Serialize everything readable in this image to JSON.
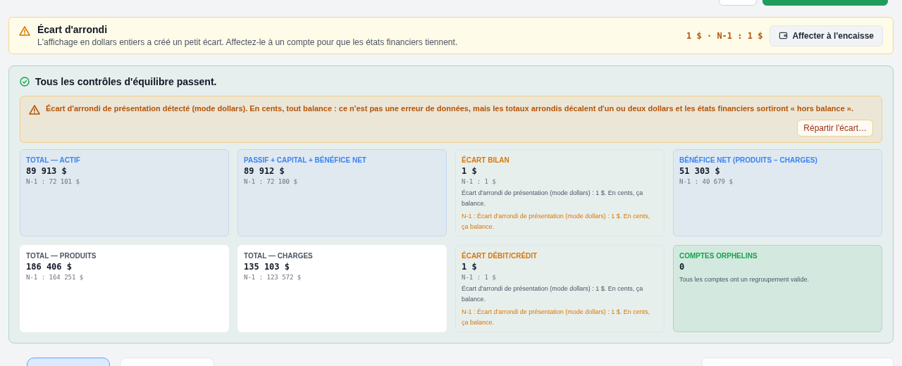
{
  "banner": {
    "title": "Écart d'arrondi",
    "message": "L'affichage en dollars entiers a créé un petit écart. Affectez-le à un compte pour que les états financiers tiennent.",
    "amounts": "1 $ · N-1 : 1 $",
    "button": "Affecter à l'encaisse"
  },
  "checks": {
    "status": "Tous les contrôles d'équilibre passent.",
    "passed": true,
    "alert": {
      "message": "Écart d'arrondi de présentation détecté (mode dollars). En cents, tout balance : ce n'est pas une erreur de données, mais les totaux arrondis décalent d'un ou deux dollars et les états financiers sortiront « hors balance ».",
      "button": "Répartir l'écart…"
    },
    "cards": [
      {
        "kind": "info",
        "label": "TOTAL — ACTIF",
        "value": "89 913 $",
        "previous": "N-1 : 72 101 $"
      },
      {
        "kind": "info",
        "label": "PASSIF + CAPITAL + BÉNÉFICE NET",
        "value": "89 912 $",
        "previous": "N-1 : 72 100 $"
      },
      {
        "kind": "warning",
        "label": "ÉCART BILAN",
        "value": "1 $",
        "previous": "N-1 : 1 $",
        "note": "Écart d'arrondi de présentation (mode dollars) : 1 $. En cents, ça balance.",
        "note_previous": "N-1 : Écart d'arrondi de présentation (mode dollars) : 1 $. En cents, ça balance."
      },
      {
        "kind": "info",
        "label": "BÉNÉFICE NET (PRODUITS − CHARGES)",
        "value": "51 303 $",
        "previous": "N-1 : 40 679 $"
      },
      {
        "kind": "neutral",
        "label": "TOTAL — PRODUITS",
        "value": "186 406 $",
        "previous": "N-1 : 164 251 $"
      },
      {
        "kind": "neutral",
        "label": "TOTAL — CHARGES",
        "value": "135 103 $",
        "previous": "N-1 : 123 572 $"
      },
      {
        "kind": "warning",
        "label": "ÉCART DÉBIT/CRÉDIT",
        "value": "1 $",
        "previous": "N-1 : 1 $",
        "note": "Écart d'arrondi de présentation (mode dollars) : 1 $. En cents, ça balance.",
        "note_previous": "N-1 : Écart d'arrondi de présentation (mode dollars) : 1 $. En cents, ça balance."
      },
      {
        "kind": "success",
        "label": "COMPTES ORPHELINS",
        "value": "0",
        "note": "Tous les comptes ont un regroupement valide."
      }
    ]
  }
}
